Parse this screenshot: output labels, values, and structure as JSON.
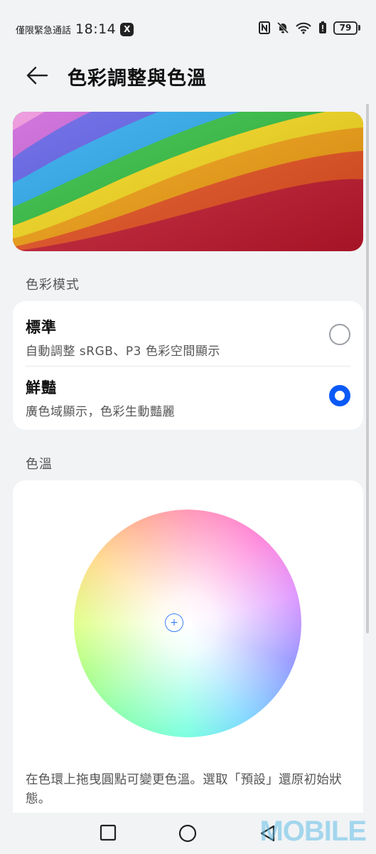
{
  "status_bar": {
    "carrier": "僅限緊急通話",
    "time": "18:14",
    "app_badge": "X",
    "battery": "79"
  },
  "header": {
    "title": "色彩調整與色溫"
  },
  "color_mode": {
    "section_label": "色彩模式",
    "options": [
      {
        "title": "標準",
        "subtitle": "自動調整 sRGB、P3 色彩空間顯示",
        "selected": false
      },
      {
        "title": "鮮豔",
        "subtitle": "廣色域顯示，色彩生動豔麗",
        "selected": true
      }
    ]
  },
  "color_temp": {
    "section_label": "色溫",
    "description": "在色環上拖曳圓點可變更色溫。選取「預設」還原初始狀態。"
  },
  "watermark": "MOBILE",
  "accent_color": "#0a59f7",
  "icons": [
    "back-arrow-icon",
    "nfc-icon",
    "mute-bell-icon",
    "wifi-icon",
    "battery-saver-icon",
    "battery-icon",
    "recents-square-icon",
    "home-circle-icon",
    "back-triangle-icon"
  ]
}
